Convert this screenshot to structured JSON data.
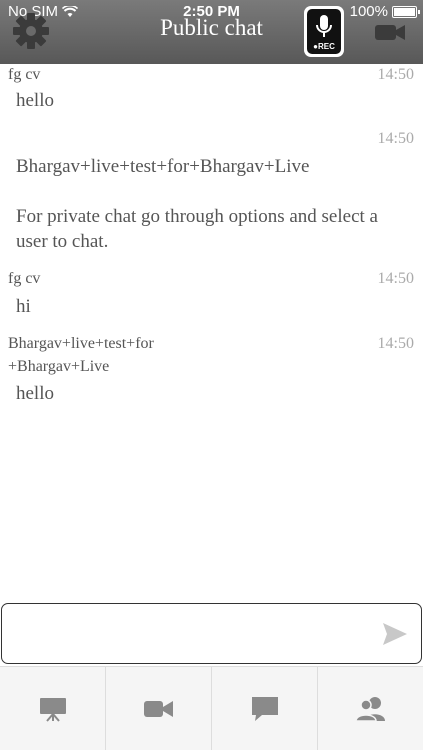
{
  "status_bar": {
    "carrier": "No SIM",
    "time": "2:50 PM",
    "battery": "100%"
  },
  "header": {
    "title": "Public chat",
    "rec_label": "REC",
    "icons": [
      "gear-icon",
      "microphone-icon",
      "video-camera-icon"
    ]
  },
  "messages": [
    {
      "sender": "fg cv",
      "time": "14:50",
      "text": "hello"
    },
    {
      "sender": "",
      "time": "14:50",
      "text": "Bhargav+live+test+for+Bhargav+Live",
      "note": "For private chat go through options and select a user to chat."
    },
    {
      "sender": "fg cv",
      "time": "14:50",
      "text": "hi"
    },
    {
      "sender": "Bhargav+live+test+for\n+Bhargav+Live",
      "sender_line1": "Bhargav+live+test+for",
      "sender_line2": "+Bhargav+Live",
      "time": "14:50",
      "text": "hello"
    }
  ],
  "input": {
    "value": "",
    "placeholder": ""
  },
  "tabbar": {
    "tabs": [
      "presentation-icon",
      "video-icon",
      "chat-icon",
      "users-icon"
    ]
  },
  "colors": {
    "header": "#666666",
    "text": "#555555",
    "timestamp": "#aaaaaa",
    "tabbar_bg": "#f5f5f5",
    "icon": "#8a8a8a"
  }
}
